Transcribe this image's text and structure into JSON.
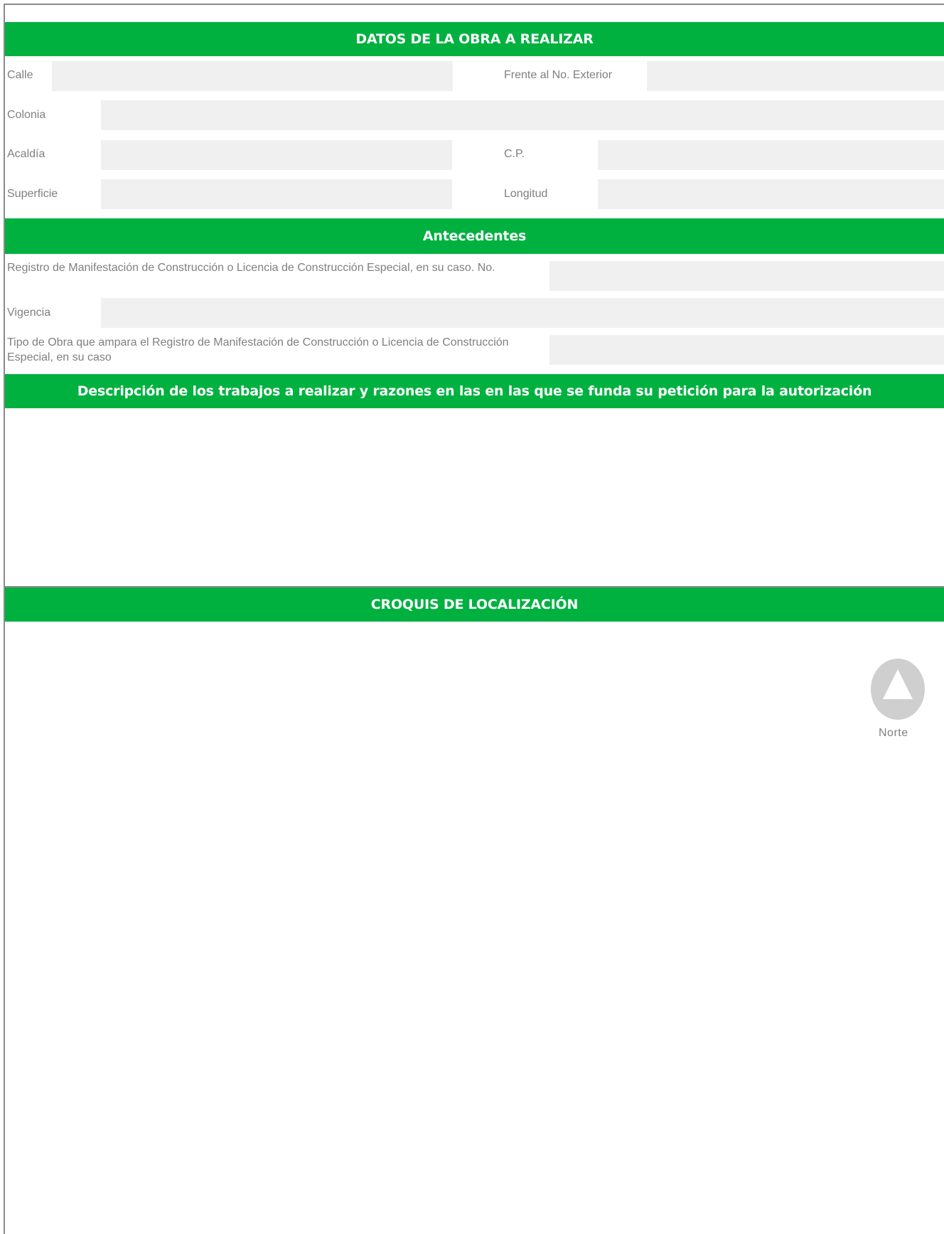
{
  "datos_obra": {
    "header": "DATOS DE LA OBRA A REALIZAR",
    "calle_label": "Calle",
    "frente_label": "Frente al No. Exterior",
    "colonia_label": "Colonia",
    "alcaldia_label": "Acaldía",
    "cp_label": "C.P.",
    "superficie_label": "Superficie",
    "longitud_label": "Longitud"
  },
  "antecedentes": {
    "header": "Antecedentes",
    "registro_label": "Registro de Manifestación de Construcción o Licencia de Construcción Especial, en su caso. No.",
    "vigencia_label": "Vigencia",
    "tipo_obra_label": "Tipo de Obra que ampara el Registro de Manifestación de Construcción o Licencia de Construcción Especial, en su caso"
  },
  "descripcion": {
    "header": "Descripción de los trabajos a realizar y razones en las en las que se funda su petición para la autorización"
  },
  "croquis": {
    "header": "CROQUIS DE LOCALIZACIÓN",
    "north_label": "Norte",
    "north_icon": "north-arrow-icon"
  },
  "colors": {
    "header_green": "#00b140",
    "field_gray": "#f0f0f0",
    "border_gray": "#8a8a8a"
  }
}
